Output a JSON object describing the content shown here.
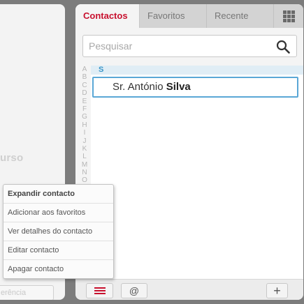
{
  "left_panel": {
    "partial_text": "urso",
    "bottom_button_label": "erência"
  },
  "tabs": [
    {
      "label": "Contactos",
      "active": true
    },
    {
      "label": "Favoritos",
      "active": false
    },
    {
      "label": "Recente",
      "active": false
    }
  ],
  "tabs_extra_icon": "grid-icon",
  "search": {
    "placeholder": "Pesquisar",
    "value": "",
    "icon": "search-icon"
  },
  "alphabet": [
    "A",
    "B",
    "C",
    "D",
    "E",
    "F",
    "G",
    "H",
    "I",
    "J",
    "K",
    "L",
    "M",
    "N",
    "O"
  ],
  "contacts": {
    "section_letter": "S",
    "rows": [
      {
        "prefix": "Sr. António",
        "surname": "Silva"
      }
    ]
  },
  "footer": {
    "menu_icon": "menu-icon",
    "at_label": "@",
    "plus_label": "+"
  },
  "context_menu": {
    "items": [
      "Expandir contacto",
      "Adicionar aos favoritos",
      "Ver detalhes do contacto",
      "Editar contacto",
      "Apagar contacto"
    ]
  },
  "colors": {
    "accent_red": "#c8102e",
    "selection_blue": "#5aa7d6",
    "section_blue": "#3a96c9"
  }
}
